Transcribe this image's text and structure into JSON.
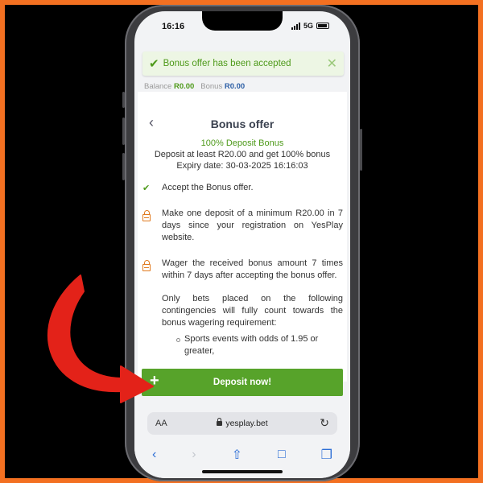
{
  "status": {
    "time": "16:16",
    "network": "5G"
  },
  "toast": {
    "message": "Bonus offer has been accepted",
    "close_icon": "close-icon",
    "check_icon": "check-icon"
  },
  "balance": {
    "label": "Balance",
    "value": "R0.00",
    "bonus_label": "Bonus",
    "bonus_value": "R0.00"
  },
  "offer": {
    "title": "Bonus offer",
    "name": "100% Deposit Bonus",
    "description": "Deposit at least R20.00 and get 100% bonus",
    "expiry": "Expiry date: 30-03-2025 16:16:03"
  },
  "steps": [
    {
      "icon": "check-icon",
      "text": "Accept the Bonus offer."
    },
    {
      "icon": "lock-icon",
      "text": "Make one deposit of a minimum R20.00 in 7 days since your registration on YesPlay website."
    },
    {
      "icon": "lock-icon",
      "text": "Wager the received bonus amount 7 times within 7 days after accepting the bonus offer."
    }
  ],
  "note": "Only bets placed on the following contingencies will fully count towards the bonus wagering requirement:",
  "sub_items": [
    "Sports events with odds of 1.95 or greater,"
  ],
  "deposit_button": {
    "label": "Deposit now!",
    "icon": "plus-icon"
  },
  "browser": {
    "aa_label": "AA",
    "url": "yesplay.bet"
  },
  "colors": {
    "brand_green": "#57a32a",
    "accent_orange": "#f37021",
    "arrow_red": "#e32219",
    "lock_orange": "#e07a1f"
  }
}
